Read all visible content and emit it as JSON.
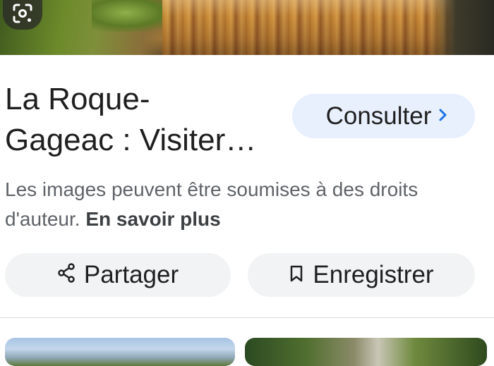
{
  "result": {
    "title": "La Roque-Gageac : Visiter…",
    "title_line1": "La Roque-",
    "title_line2": "Gageac : Visiter…",
    "visit_button_label": "Consulter"
  },
  "notice": {
    "text": "Les images peuvent être soumises à des droits d'auteur.",
    "link_label": "En savoir plus"
  },
  "actions": {
    "share_label": "Partager",
    "save_label": "Enregistrer"
  },
  "icons": {
    "lens": "lens-icon",
    "chevron": "chevron-right-icon",
    "share": "share-icon",
    "bookmark": "bookmark-icon"
  },
  "colors": {
    "accent": "#1a73e8",
    "visit_button_bg": "#e8f0fe",
    "action_button_bg": "#f1f3f4"
  }
}
